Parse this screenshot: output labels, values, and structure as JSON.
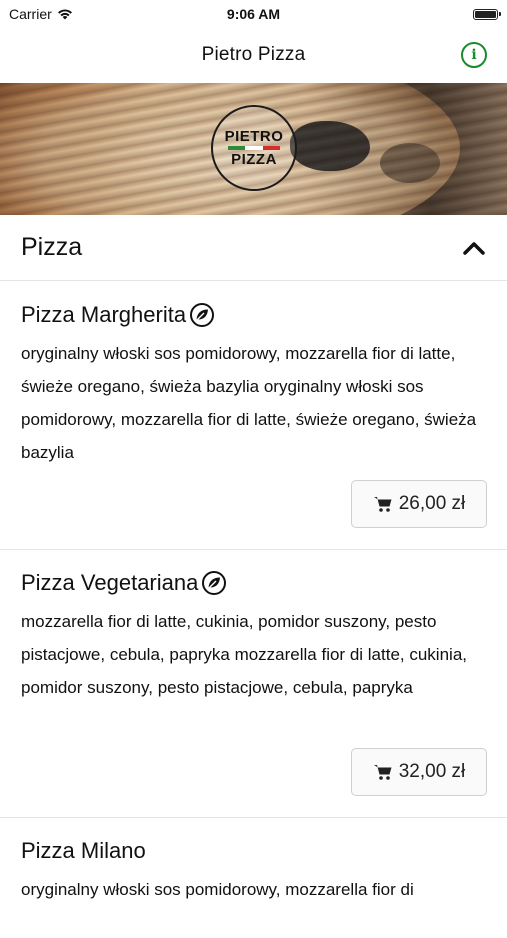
{
  "status_bar": {
    "carrier": "Carrier",
    "time": "9:06 AM"
  },
  "nav": {
    "title": "Pietro Pizza",
    "info_icon": "info-icon",
    "accent_color": "#1a8a2e"
  },
  "hero": {
    "logo_line1": "PIETRO",
    "logo_line2": "PIZZA",
    "flag_colors": [
      "#2e8b3a",
      "#ffffff",
      "#d32f2f"
    ]
  },
  "section": {
    "title": "Pizza",
    "state": "expanded"
  },
  "items": [
    {
      "name": "Pizza Margherita",
      "vegetarian": true,
      "description": "oryginalny włoski sos pomidorowy, mozzarella fior di latte, świeże oregano, świeża bazylia oryginalny włoski sos pomidorowy, mozzarella fior di latte, świeże oregano, świeża bazylia",
      "price": "26,00 zł"
    },
    {
      "name": "Pizza Vegetariana",
      "vegetarian": true,
      "description": "mozzarella fior di latte, cukinia, pomidor suszony, pesto pistacjowe, cebula, papryka mozzarella fior di latte, cukinia, pomidor suszony, pesto pistacjowe, cebula, papryka",
      "price": "32,00 zł"
    },
    {
      "name": "Pizza Milano",
      "vegetarian": false,
      "description": "oryginalny włoski sos pomidorowy, mozzarella fior di"
    }
  ]
}
